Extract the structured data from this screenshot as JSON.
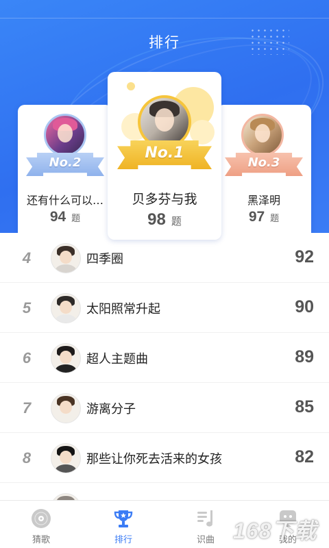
{
  "header": {
    "title": "排行"
  },
  "podium": {
    "second": {
      "badge": "No.2",
      "name": "还有什么可以…",
      "score": "94",
      "unit": "题"
    },
    "first": {
      "badge": "No.1",
      "name": "贝多芬与我",
      "score": "98",
      "unit": "题"
    },
    "third": {
      "badge": "No.3",
      "name": "黑泽明",
      "score": "97",
      "unit": "题"
    }
  },
  "ranking": [
    {
      "rank": "4",
      "name": "四季圈",
      "score": "92"
    },
    {
      "rank": "5",
      "name": "太阳照常升起",
      "score": "90"
    },
    {
      "rank": "6",
      "name": "超人主题曲",
      "score": "89"
    },
    {
      "rank": "7",
      "name": "游离分子",
      "score": "85"
    },
    {
      "rank": "8",
      "name": "那些让你死去活来的女孩",
      "score": "82"
    },
    {
      "rank": "",
      "name": "",
      "score": ""
    }
  ],
  "tabbar": {
    "tabs": [
      {
        "label": "猜歌",
        "icon": "disc-icon"
      },
      {
        "label": "排行",
        "icon": "trophy-icon",
        "active": true
      },
      {
        "label": "识曲",
        "icon": "music-list-icon"
      },
      {
        "label": "我的",
        "icon": "profile-icon"
      }
    ]
  },
  "watermark": {
    "text": "168下载"
  },
  "colors": {
    "accent": "#3b7cf5",
    "gold": "#f6c53c",
    "silver": "#aac6f2",
    "bronze": "#f3b7a2"
  }
}
